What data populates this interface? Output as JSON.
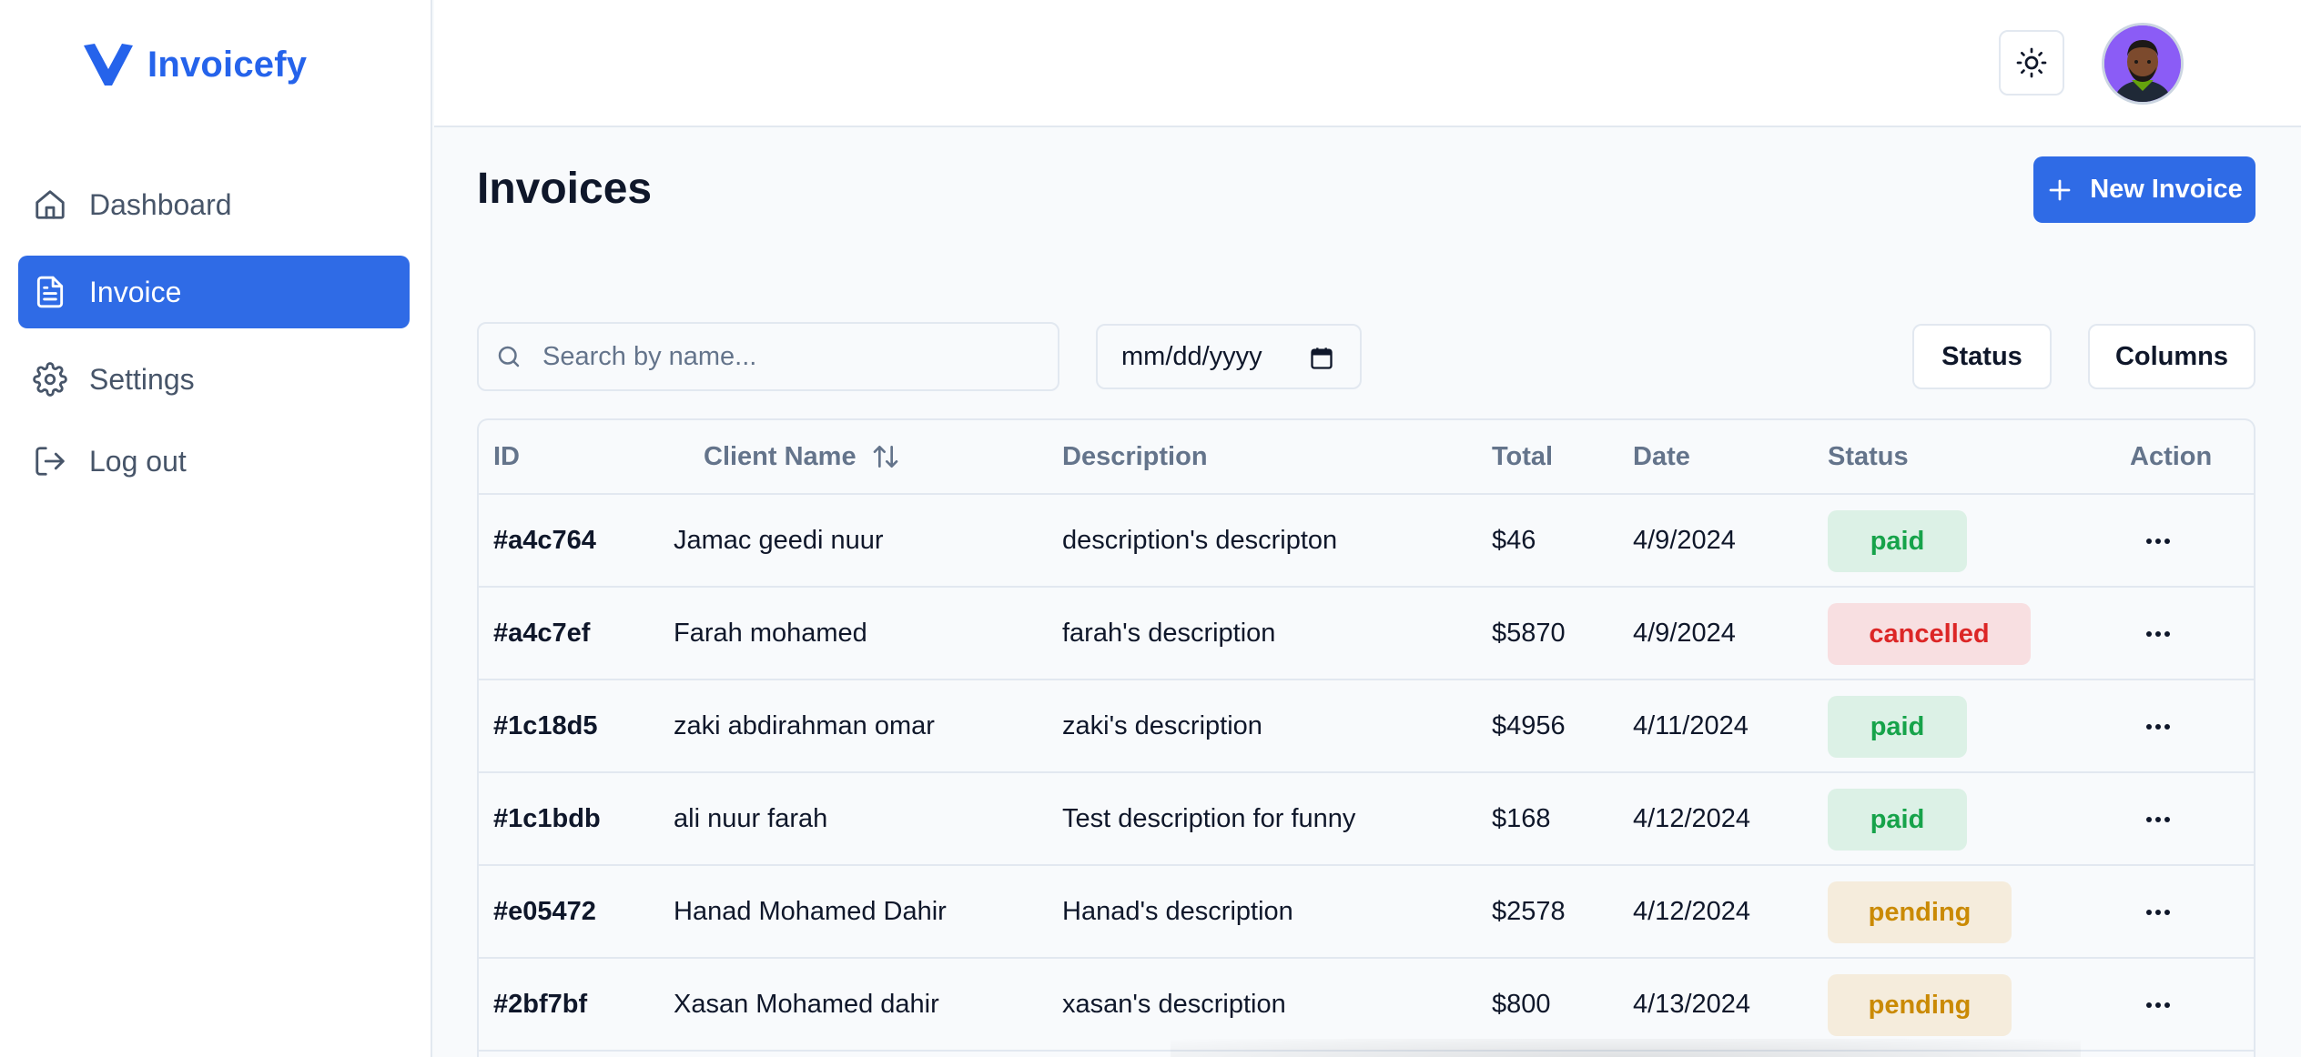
{
  "brand": {
    "name": "Invoicefy",
    "color": "#2563eb"
  },
  "sidebar": {
    "items": [
      {
        "label": "Dashboard",
        "icon": "home-icon"
      },
      {
        "label": "Invoice",
        "icon": "file-text-icon",
        "active": true
      },
      {
        "label": "Settings",
        "icon": "gear-icon"
      },
      {
        "label": "Log out",
        "icon": "log-out-icon"
      }
    ]
  },
  "header": {
    "theme_icon": "sun-icon",
    "avatar": "user-avatar"
  },
  "page": {
    "title": "Invoices",
    "new_button": "New Invoice"
  },
  "filters": {
    "search_placeholder": "Search by name...",
    "date_placeholder": "mm/dd/yyyy",
    "status_button": "Status",
    "columns_button": "Columns"
  },
  "table": {
    "columns": [
      "ID",
      "Client Name",
      "Description",
      "Total",
      "Date",
      "Status",
      "Action"
    ],
    "rows": [
      {
        "id": "#a4c764",
        "client": "Jamac geedi nuur",
        "description": "description's descripton",
        "total": "$46",
        "date": "4/9/2024",
        "status": "paid"
      },
      {
        "id": "#a4c7ef",
        "client": "Farah mohamed",
        "description": "farah's description",
        "total": "$5870",
        "date": "4/9/2024",
        "status": "cancelled"
      },
      {
        "id": "#1c18d5",
        "client": "zaki abdirahman omar",
        "description": "zaki's description",
        "total": "$4956",
        "date": "4/11/2024",
        "status": "paid"
      },
      {
        "id": "#1c1bdb",
        "client": "ali nuur farah",
        "description": "Test description for funny",
        "total": "$168",
        "date": "4/12/2024",
        "status": "paid"
      },
      {
        "id": "#e05472",
        "client": "Hanad Mohamed Dahir",
        "description": "Hanad's description",
        "total": "$2578",
        "date": "4/12/2024",
        "status": "pending"
      },
      {
        "id": "#2bf7bf",
        "client": "Xasan Mohamed dahir",
        "description": "xasan's description",
        "total": "$800",
        "date": "4/13/2024",
        "status": "pending"
      }
    ]
  },
  "colors": {
    "primary": "#2f6be6",
    "paid": "#16a34a",
    "cancelled": "#dc2626",
    "pending": "#ca8a04"
  }
}
